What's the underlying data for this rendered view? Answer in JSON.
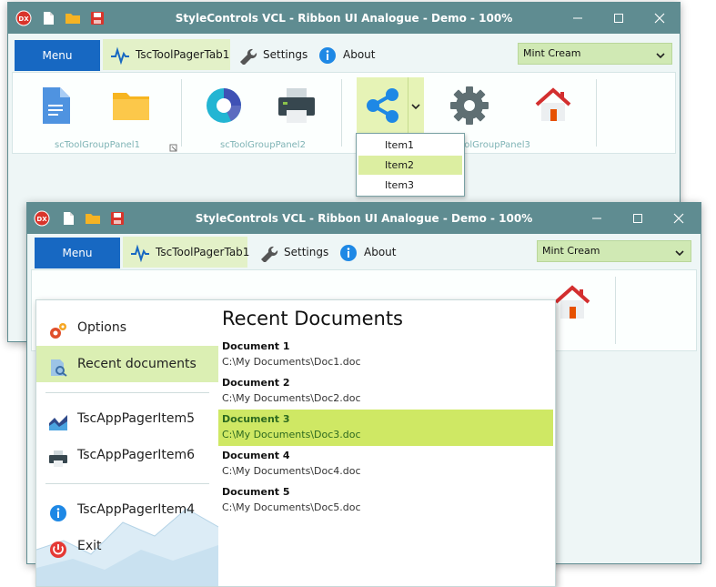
{
  "window_back": {
    "title": "StyleControls VCL - Ribbon UI Analogue - Demo - 100%",
    "menu_label": "Menu",
    "tabs": [
      {
        "label": "TscToolPagerTab1",
        "active": true
      },
      {
        "label": "Settings"
      },
      {
        "label": "About"
      }
    ],
    "style_combo": "Mint Cream",
    "groups": [
      {
        "caption": "scToolGroupPanel1"
      },
      {
        "caption": "scToolGroupPanel2"
      },
      {
        "caption": "scToolGroupPanel3"
      }
    ],
    "dropdown_items": [
      "Item1",
      "Item2",
      "Item3"
    ]
  },
  "window_front": {
    "title": "StyleControls VCL - Ribbon UI Analogue - Demo - 100%",
    "menu_label": "Menu",
    "tabs": [
      {
        "label": "TscToolPagerTab1",
        "active": true
      },
      {
        "label": "Settings"
      },
      {
        "label": "About"
      }
    ],
    "style_combo": "Mint Cream"
  },
  "app_pager": {
    "items": [
      {
        "label": "Options",
        "icon": "gears-icon"
      },
      {
        "label": "Recent documents",
        "icon": "recent-docs-icon",
        "selected": true
      },
      {
        "label": "TscAppPagerItem5",
        "icon": "chart-icon"
      },
      {
        "label": "TscAppPagerItem6",
        "icon": "printer-icon"
      },
      {
        "label": "TscAppPagerItem4",
        "icon": "info-icon"
      },
      {
        "label": "Exit",
        "icon": "power-icon"
      }
    ],
    "recent_title": "Recent Documents",
    "documents": [
      {
        "name": "Document 1",
        "path": "C:\\My Documents\\Doc1.doc"
      },
      {
        "name": "Document 2",
        "path": "C:\\My Documents\\Doc2.doc"
      },
      {
        "name": "Document 3",
        "path": "C:\\My Documents\\Doc3.doc",
        "selected": true
      },
      {
        "name": "Document 4",
        "path": "C:\\My Documents\\Doc4.doc"
      },
      {
        "name": "Document 5",
        "path": "C:\\My Documents\\Doc5.doc"
      }
    ]
  },
  "colors": {
    "titlebar": "#5f8c91",
    "menu_button": "#1768c2",
    "accent_green": "#cfe864",
    "selection_green": "#dbefb3"
  }
}
